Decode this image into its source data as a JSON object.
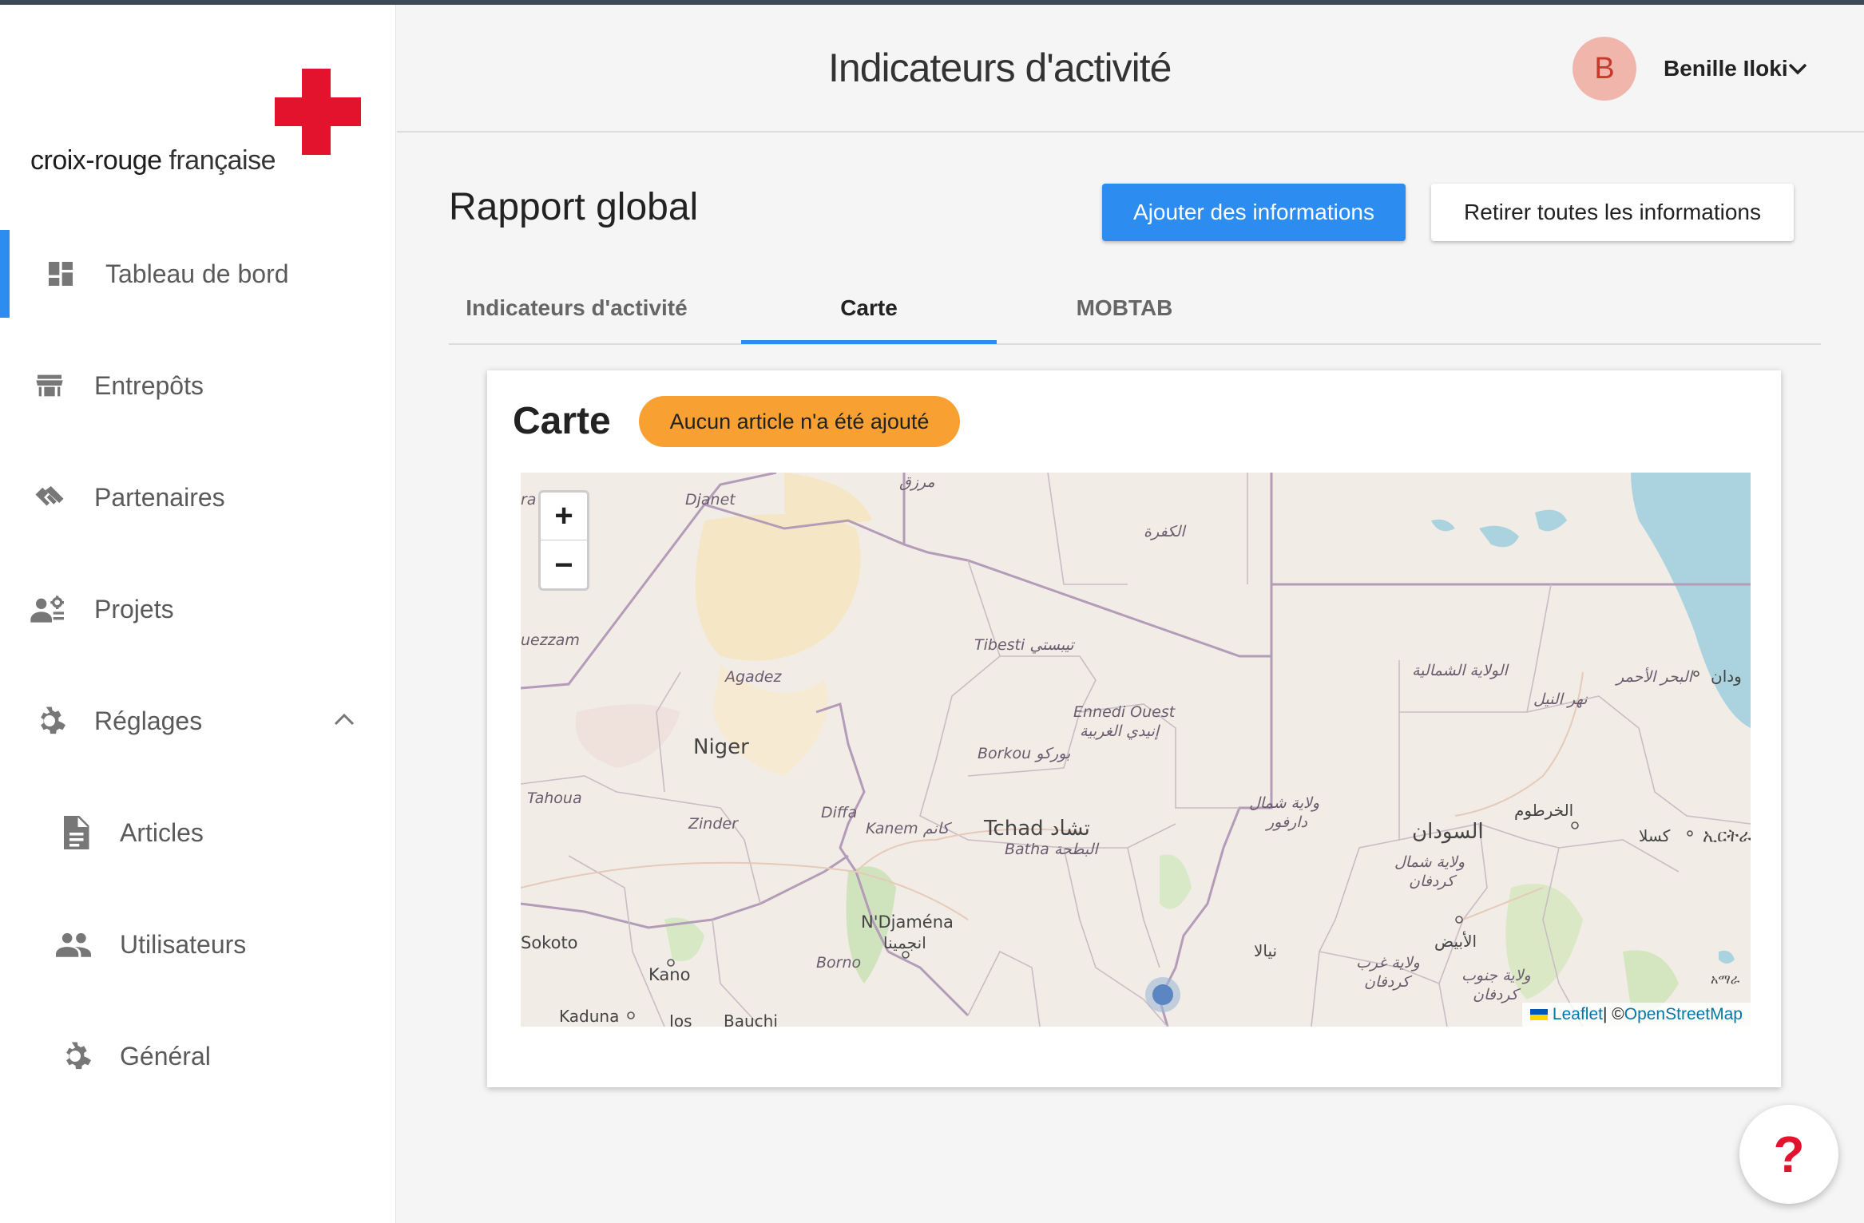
{
  "brand": {
    "logo_text_1": "croix-rouge",
    "logo_text_2": " française",
    "cross_color": "#e3122d"
  },
  "sidebar": {
    "items": [
      {
        "label": "Tableau de bord",
        "icon": "dashboard-icon",
        "active": true
      },
      {
        "label": "Entrepôts",
        "icon": "warehouse-icon"
      },
      {
        "label": "Partenaires",
        "icon": "handshake-icon"
      },
      {
        "label": "Projets",
        "icon": "project-icon"
      },
      {
        "label": "Réglages",
        "icon": "gear-icon",
        "expanded": true
      },
      {
        "label": "Articles",
        "icon": "document-icon"
      },
      {
        "label": "Utilisateurs",
        "icon": "users-icon"
      },
      {
        "label": "Général",
        "icon": "gear-icon"
      }
    ],
    "accent": "#2d8cf0"
  },
  "header": {
    "title": "Indicateurs d'activité",
    "user": {
      "initial": "B",
      "name": "Benille Iloki"
    }
  },
  "main": {
    "title": "Rapport global",
    "add_button": "Ajouter des informations",
    "remove_button": "Retirer toutes les informations",
    "tabs": [
      {
        "label": "Indicateurs d'activité"
      },
      {
        "label": "Carte",
        "active": true
      },
      {
        "label": "MOBTAB"
      }
    ]
  },
  "card": {
    "title": "Carte",
    "badge": "Aucun article n'a été ajouté",
    "badge_color": "#f8a132"
  },
  "map": {
    "zoom_in": "+",
    "zoom_out": "−",
    "attribution_leaflet": "Leaflet",
    "attribution_sep": " | © ",
    "attribution_osm": "OpenStreetMap",
    "labels": {
      "djanet": "Djanet",
      "murzuq": "مرزق",
      "kufra": "الكفرة",
      "in_guezzam": "uezzam",
      "agadez": "Agadez",
      "niger": "Niger",
      "tibesti": "Tibesti تيبستي",
      "ennedi_ouest": "Ennedi Ouest",
      "ennedi_ouest_ar": "إنيدي الغربية",
      "borkou": "Borkou بوركو",
      "northern_state": "الولاية الشمالية",
      "red_sea": "البحر الأحمر",
      "nile": "نهر النيل",
      "sudan_edge": "ودان",
      "tahoua": "Tahoua",
      "zinder": "Zinder",
      "diffa": "Diffa",
      "kanem": "Kanem كانم",
      "tchad": "Tchad تشاد",
      "batha": "Batha البطحة",
      "north_darfur": "ولاية شمال",
      "north_darfur_2": "دارفور",
      "khartoum": "الخرطوم",
      "sudan": "السودان",
      "north_kordofan": "ولاية شمال",
      "north_kordofan_2": "كردفان",
      "kassala": "كسلا",
      "ethiopia_edge": "ኢርትራ",
      "ndjamena": "N'Djaména",
      "ndjamena_ar": "انجمينا",
      "sokoto": "Sokoto",
      "kano": "Kano",
      "borno": "Borno",
      "nyala": "نيالا",
      "el_obeid": "الأبيض",
      "west_kordofan": "ولاية غرب",
      "west_kordofan_2": "كردفان",
      "south_kordofan": "ولاية جنوب",
      "south_kordofan_2": "كردفان",
      "kaduna": "Kaduna",
      "jos": "Jos",
      "bauchi": "Bauchi",
      "amhara_edge": "አማራ"
    }
  },
  "help": {
    "label": "?"
  }
}
